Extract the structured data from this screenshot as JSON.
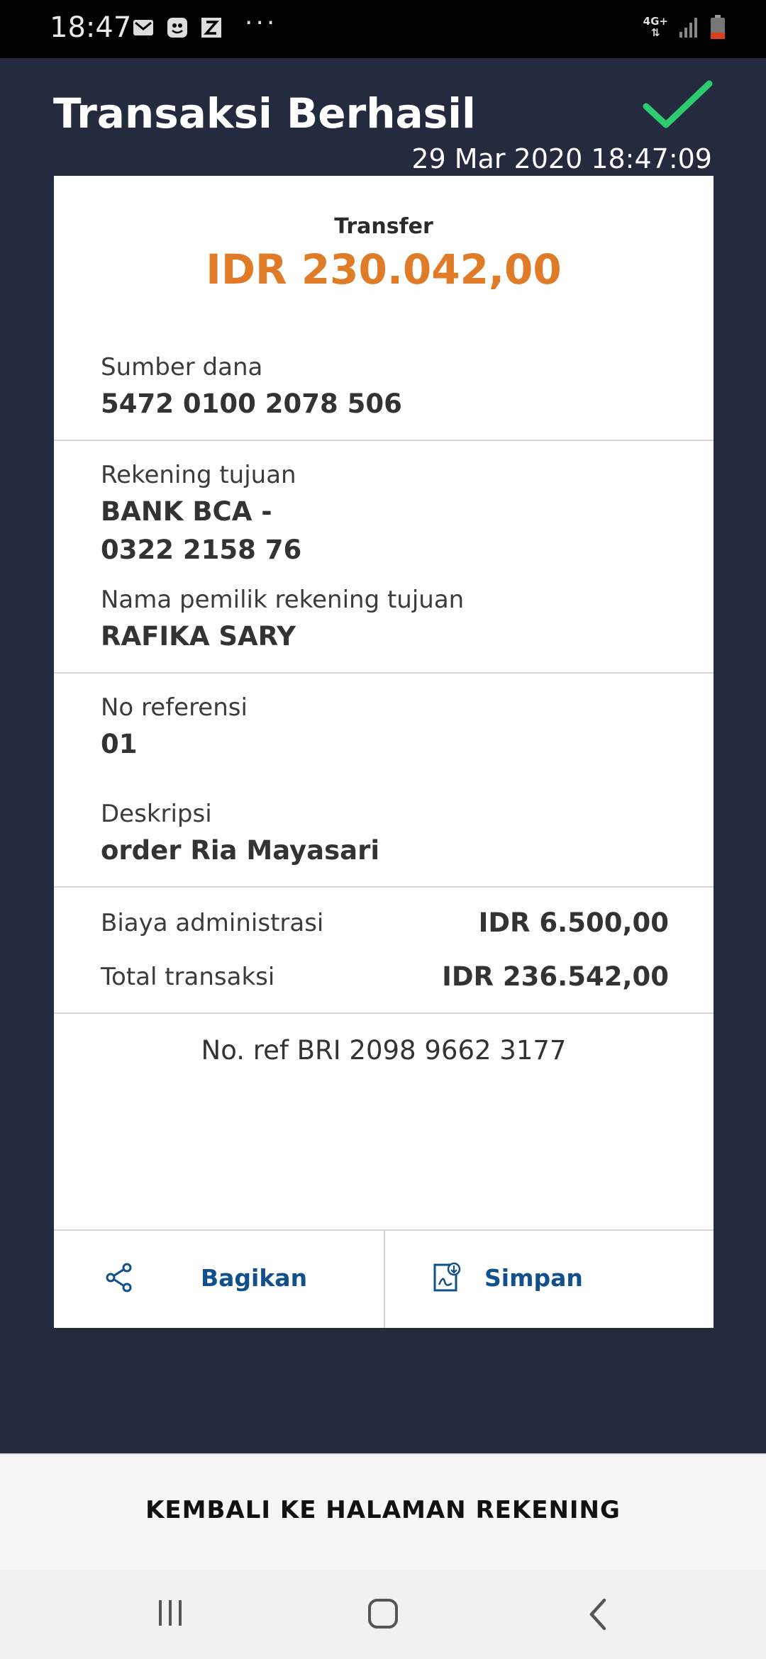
{
  "status_bar": {
    "time": "18:47",
    "notification_icons": [
      "gmail-icon",
      "shield-app-icon",
      "z-app-icon"
    ],
    "more": "···",
    "network_label": "4G+",
    "signal_icon": "signal-icon",
    "battery_icon": "battery-low-icon"
  },
  "header": {
    "title": "Transaksi Berhasil",
    "datetime": "29 Mar 2020 18:47:09",
    "status_icon": "check-icon",
    "accent_color": "#2ecc71"
  },
  "receipt": {
    "type": "Transfer",
    "amount": "IDR 230.042,00",
    "amount_color": "#e07b27",
    "source_label": "Sumber dana",
    "source_value": "5472 0100 2078 506",
    "dest_label": "Rekening tujuan",
    "dest_bank": "BANK BCA -",
    "dest_account": "0322 2158 76",
    "owner_label": "Nama pemilik rekening tujuan",
    "owner_value": "RAFIKA SARY",
    "ref_label": "No referensi",
    "ref_value": "01",
    "desc_label": "Deskripsi",
    "desc_value": "order Ria Mayasari",
    "fee_label": "Biaya administrasi",
    "fee_value": "IDR 6.500,00",
    "total_label": "Total transaksi",
    "total_value": "IDR 236.542,00",
    "bri_ref": "No. ref BRI 2098 9662 3177"
  },
  "actions": {
    "share_label": "Bagikan",
    "share_icon": "share-icon",
    "save_label": "Simpan",
    "save_icon": "pdf-download-icon"
  },
  "footer": {
    "back_label": "KEMBALI KE HALAMAN REKENING"
  },
  "nav": {
    "recents_icon": "recents-icon",
    "home_icon": "home-icon",
    "back_icon": "back-icon"
  }
}
